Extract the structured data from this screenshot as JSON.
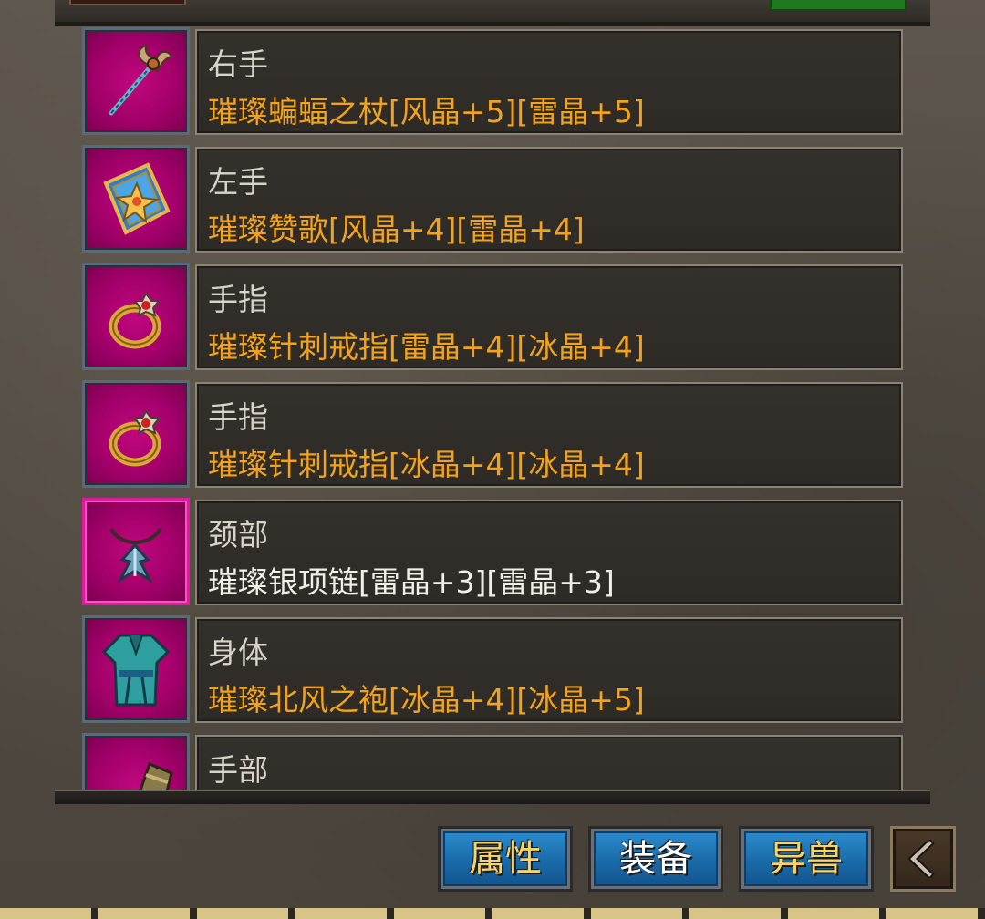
{
  "equipment": [
    {
      "slot": "右手",
      "item": "璀璨蝙蝠之杖[风晶+5][雷晶+5]",
      "icon": "staff-icon",
      "quality_color": "#f3a21d"
    },
    {
      "slot": "左手",
      "item": "璀璨赞歌[风晶+4][雷晶+4]",
      "icon": "book-icon",
      "quality_color": "#f3a21d"
    },
    {
      "slot": "手指",
      "item": "璀璨针刺戒指[雷晶+4][冰晶+4]",
      "icon": "ring-icon",
      "quality_color": "#f3a21d"
    },
    {
      "slot": "手指",
      "item": "璀璨针刺戒指[冰晶+4][冰晶+4]",
      "icon": "ring-icon",
      "quality_color": "#f3a21d"
    },
    {
      "slot": "颈部",
      "item": "璀璨银项链[雷晶+3][雷晶+3]",
      "icon": "necklace-icon",
      "quality_color": "#f2efe8"
    },
    {
      "slot": "身体",
      "item": "璀璨北风之袍[冰晶+4][冰晶+5]",
      "icon": "robe-icon",
      "quality_color": "#f3a21d"
    },
    {
      "slot": "手部",
      "item": "",
      "icon": "gauntlet-icon",
      "quality_color": "#f3a21d"
    }
  ],
  "tabs": [
    {
      "label": "属性"
    },
    {
      "label": "装备"
    },
    {
      "label": "异兽"
    }
  ],
  "back_button": {
    "icon": "back-arrow-icon"
  }
}
